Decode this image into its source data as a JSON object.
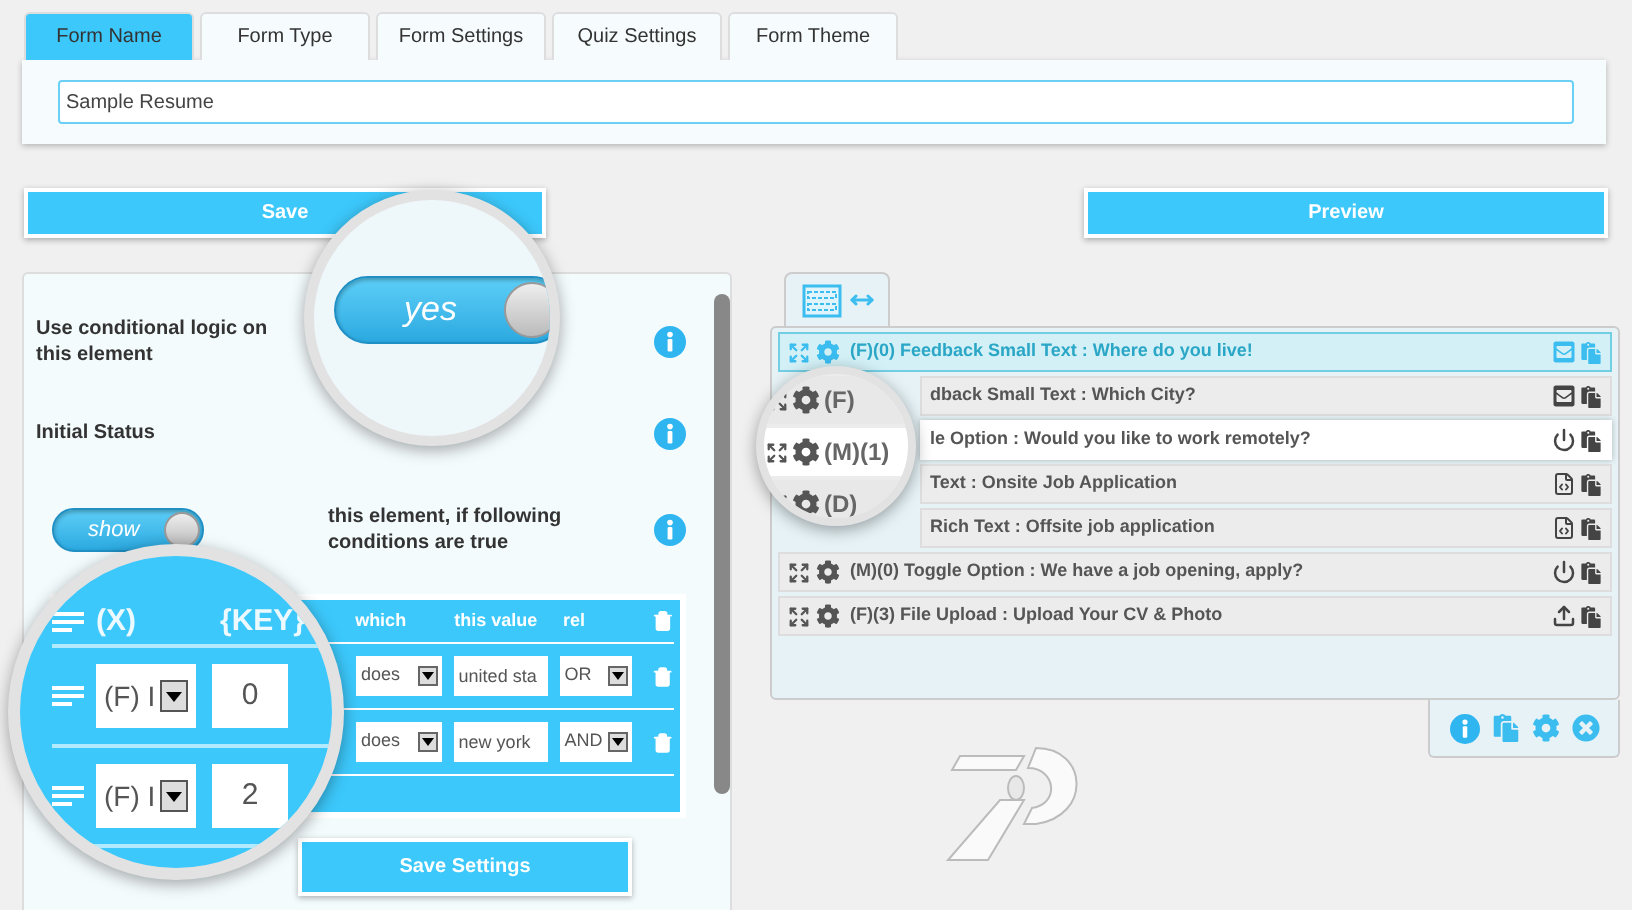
{
  "tabs": [
    {
      "label": "Form Name",
      "selected": true
    },
    {
      "label": "Form Type",
      "selected": false
    },
    {
      "label": "Form Settings",
      "selected": false
    },
    {
      "label": "Quiz Settings",
      "selected": false
    },
    {
      "label": "Form Theme",
      "selected": false
    }
  ],
  "form_name": {
    "value": "Sample Resume"
  },
  "save_button": "Save",
  "preview_button": "Preview",
  "conditional_logic": {
    "label": "Use conditional logic on this element"
  },
  "initial_status": {
    "label": "Initial Status"
  },
  "action": {
    "toggle_text": "show",
    "on": true,
    "label": "this element, if following conditions are true"
  },
  "conditions": {
    "columns": [
      "which",
      "this value",
      "rel"
    ],
    "rows": [
      {
        "which": "does",
        "value": "united sta",
        "rel": "OR"
      },
      {
        "which": "does",
        "value": "new york",
        "rel": "AND"
      }
    ]
  },
  "save_settings_button": "Save Settings",
  "magnifier_toggle": {
    "toggle_text": "yes",
    "on": true
  },
  "magnifier_conditions": {
    "columns": [
      "(X)",
      "{KEY}"
    ],
    "rows": [
      {
        "field": "(F) I",
        "key": "0"
      },
      {
        "field": "(F) I",
        "key": "2"
      }
    ]
  },
  "elements": [
    {
      "text": "(F)(0) Feedback Small Text : Where do you live!",
      "kind": "mail",
      "selected": true,
      "hovered": false
    },
    {
      "text": "dback Small Text : Which City?",
      "kind": "mail",
      "selected": false,
      "hovered": false
    },
    {
      "text": "le Option : Would you like to work remotely?",
      "kind": "power",
      "selected": false,
      "hovered": true
    },
    {
      "text": "Text : Onsite Job Application",
      "kind": "code",
      "selected": false,
      "hovered": false
    },
    {
      "text": "Rich Text : Offsite job application",
      "kind": "code",
      "selected": false,
      "hovered": false
    },
    {
      "text": "(M)(0) Toggle Option : We have a job opening, apply?",
      "kind": "power",
      "selected": false,
      "hovered": false
    },
    {
      "text": "(F)(3) File Upload : Upload Your CV & Photo",
      "kind": "upload",
      "selected": false,
      "hovered": false
    }
  ],
  "magnifier_elements": [
    "(F)",
    "(M)(1)",
    "(D)"
  ]
}
